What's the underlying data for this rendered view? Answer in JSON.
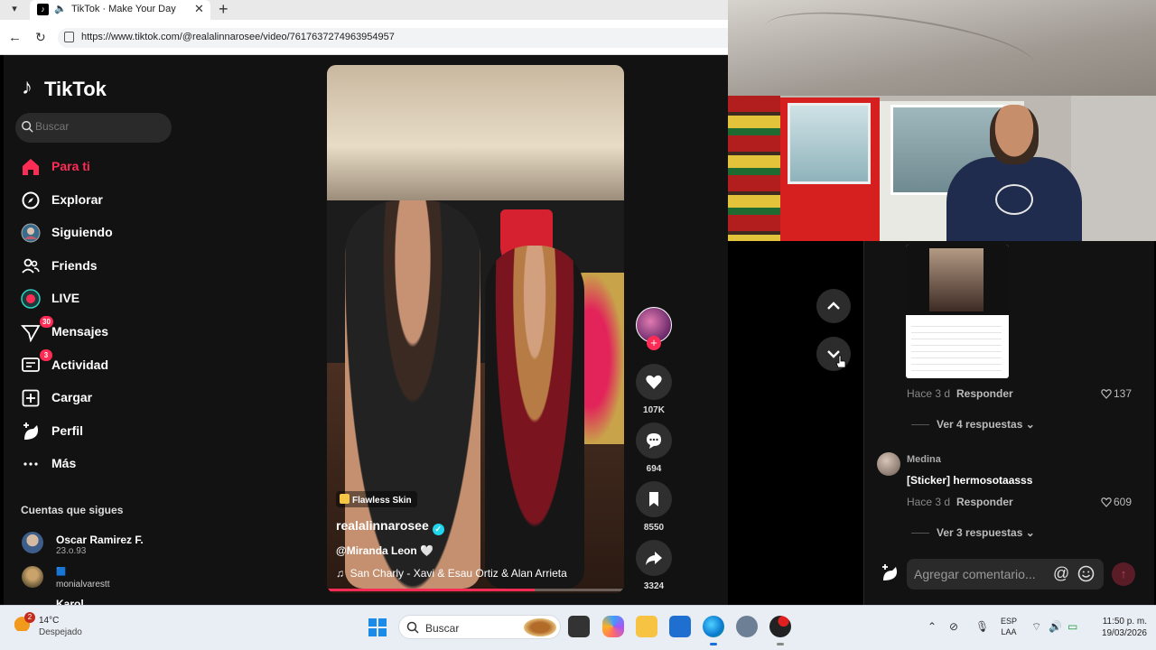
{
  "browser": {
    "tab_title": "TikTok · Make Your Day",
    "url": "https://www.tiktok.com/@realalinnarosee/video/7617637274963954957"
  },
  "sidebar": {
    "logo": "TikTok",
    "search_placeholder": "Buscar",
    "nav": [
      {
        "label": "Para ti",
        "icon": "home-icon",
        "active": true
      },
      {
        "label": "Explorar",
        "icon": "compass-icon"
      },
      {
        "label": "Siguiendo",
        "icon": "following-avatar-icon"
      },
      {
        "label": "Friends",
        "icon": "friends-icon"
      },
      {
        "label": "LIVE",
        "icon": "live-icon"
      },
      {
        "label": "Mensajes",
        "icon": "messages-icon",
        "badge": "30"
      },
      {
        "label": "Actividad",
        "icon": "activity-icon",
        "badge": "3"
      },
      {
        "label": "Cargar",
        "icon": "upload-icon"
      },
      {
        "label": "Perfil",
        "icon": "profile-icon"
      },
      {
        "label": "Más",
        "icon": "more-icon"
      }
    ],
    "following_title": "Cuentas que sigues",
    "accounts": [
      {
        "name": "Oscar Ramirez F.",
        "sub": "23.o.93"
      },
      {
        "name": "🟦",
        "sub": "monialvarestt"
      },
      {
        "name": "Karol",
        "sub": ""
      }
    ]
  },
  "video": {
    "effect": "Flawless Skin",
    "author": "realalinnarosee",
    "mention": "@Miranda Leon 🤍",
    "music": "San Charly - Xavi & Esau Ortiz & Alan Arrieta",
    "progress": 0.7
  },
  "actions": {
    "likes": "107K",
    "comments": "694",
    "saves": "8550",
    "shares": "3324"
  },
  "comments": {
    "first": {
      "time": "Hace 3 d",
      "reply": "Responder",
      "likes": "137",
      "view_replies": "Ver 4 respuestas"
    },
    "second": {
      "name": "Medina",
      "text": "[Sticker] hermosotaasss",
      "time": "Hace 3 d",
      "reply": "Responder",
      "likes": "609",
      "view_replies": "Ver 3 respuestas"
    },
    "input_placeholder": "Agregar comentario..."
  },
  "taskbar": {
    "weather_badge": "2",
    "temp": "14°C",
    "weather": "Despejado",
    "search": "Buscar",
    "lang_1": "ESP",
    "lang_2": "LAA",
    "time": "11:50 p. m.",
    "date": "19/03/2026"
  },
  "colors": {
    "accent": "#fe2c55",
    "verified": "#20d5ec",
    "bg": "#121212"
  }
}
